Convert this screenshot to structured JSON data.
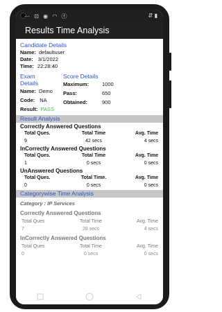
{
  "status": {
    "left_icons": "⋯ ⊡ ◉ ◠ ⓕ",
    "right_icons": "⇵ ▮"
  },
  "app": {
    "title": "Results Time Analysis"
  },
  "candidate": {
    "heading": "Candidate Details",
    "name_label": "Name:",
    "name_value": "defaultuser",
    "date_label": "Date:",
    "date_value": "3/1/2022",
    "time_label": "Time:",
    "time_value": "22:28:40"
  },
  "exam": {
    "heading_line1": "Exam",
    "heading_line2": "Details",
    "name_label": "Name:",
    "name_value": "Demo",
    "code_label": "Code:",
    "code_value": "NA",
    "result_label": "Result:",
    "result_value": "PASS",
    "result_color": "#3fbf3f"
  },
  "score": {
    "heading": "Score Details",
    "max_label": "Maximum:",
    "max_value": "1000",
    "pass_label": "Pass:",
    "pass_value": "650",
    "obtained_label": "Obtained:",
    "obtained_value": "900"
  },
  "result_analysis": {
    "heading": "Result Analysis",
    "correct": {
      "title": "Correctly Answered Questions",
      "headers": [
        "Total Ques.",
        "Total Time",
        "Avg. Time"
      ],
      "values": [
        "9",
        "42 secs",
        "4 secs"
      ]
    },
    "incorrect": {
      "title": "InCorrectly Answered Questions",
      "headers": [
        "Total Ques.",
        "Total Time",
        "Avg. Time"
      ],
      "values": [
        "1",
        "0 secs",
        "0 secs"
      ]
    },
    "unanswered": {
      "title": "UnAnswered Questions",
      "headers": [
        "Total Ques.",
        "Total Time.",
        "Avg. Time"
      ],
      "values": [
        "0",
        "0 secs",
        "0 secs"
      ]
    }
  },
  "category_analysis": {
    "heading": "Categorywise Time Analysis",
    "category_label": "Category : IP Services",
    "correct": {
      "title": "Correctly Answered Questions",
      "headers": [
        "Total Ques",
        "Total Time",
        "Avg. Time"
      ],
      "values": [
        "7",
        "28 secs",
        "4 secs"
      ]
    },
    "incorrect": {
      "title": "InCorrectly Answered Questions",
      "headers": [
        "Total Ques",
        "Total Time",
        "Avg. Time"
      ],
      "values": [
        "0",
        "0 secs",
        "0 secs"
      ]
    }
  }
}
